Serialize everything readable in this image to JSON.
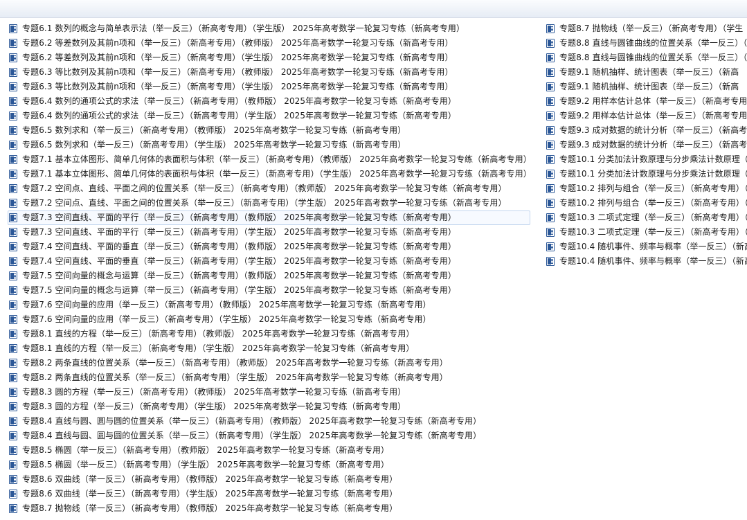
{
  "files": {
    "column1": [
      "专题6.1 数列的概念与简单表示法（举一反三）（新高考专用）（学生版） 2025年高考数学一轮复习专练（新高考专用）",
      "专题6.2 等差数列及其前n项和（举一反三）（新高考专用）（教师版） 2025年高考数学一轮复习专练（新高考专用）",
      "专题6.2 等差数列及其前n项和（举一反三）（新高考专用）（学生版） 2025年高考数学一轮复习专练（新高考专用）",
      "专题6.3 等比数列及其前n项和（举一反三）（新高考专用）（教师版） 2025年高考数学一轮复习专练（新高考专用）",
      "专题6.3 等比数列及其前n项和（举一反三）（新高考专用）（学生版） 2025年高考数学一轮复习专练（新高考专用）",
      "专题6.4 数列的通项公式的求法（举一反三）（新高考专用）（教师版） 2025年高考数学一轮复习专练（新高考专用）",
      "专题6.4 数列的通项公式的求法（举一反三）（新高考专用）（学生版） 2025年高考数学一轮复习专练（新高考专用）",
      "专题6.5 数列求和（举一反三）（新高考专用）（教师版） 2025年高考数学一轮复习专练（新高考专用）",
      "专题6.5 数列求和（举一反三）（新高考专用）（学生版） 2025年高考数学一轮复习专练（新高考专用）",
      "专题7.1 基本立体图形、简单几何体的表面积与体积（举一反三）（新高考专用）（教师版） 2025年高考数学一轮复习专练（新高考专用）",
      "专题7.1 基本立体图形、简单几何体的表面积与体积（举一反三）（新高考专用）（学生版） 2025年高考数学一轮复习专练（新高考专用）",
      "专题7.2 空间点、直线、平面之间的位置关系（举一反三）（新高考专用）（教师版） 2025年高考数学一轮复习专练（新高考专用）",
      "专题7.2 空间点、直线、平面之间的位置关系（举一反三）（新高考专用）（学生版） 2025年高考数学一轮复习专练（新高考专用）",
      "专题7.3 空间直线、平面的平行（举一反三）（新高考专用）（教师版） 2025年高考数学一轮复习专练（新高考专用）",
      "专题7.3 空间直线、平面的平行（举一反三）（新高考专用）（学生版） 2025年高考数学一轮复习专练（新高考专用）",
      "专题7.4 空间直线、平面的垂直（举一反三）（新高考专用）（教师版） 2025年高考数学一轮复习专练（新高考专用）",
      "专题7.4 空间直线、平面的垂直（举一反三）（新高考专用）（学生版） 2025年高考数学一轮复习专练（新高考专用）",
      "专题7.5 空间向量的概念与运算（举一反三）（新高考专用）（教师版） 2025年高考数学一轮复习专练（新高考专用）",
      "专题7.5 空间向量的概念与运算（举一反三）（新高考专用）（学生版） 2025年高考数学一轮复习专练（新高考专用）",
      "专题7.6 空间向量的应用（举一反三）（新高考专用）（教师版） 2025年高考数学一轮复习专练（新高考专用）",
      "专题7.6 空间向量的应用（举一反三）（新高考专用）（学生版） 2025年高考数学一轮复习专练（新高考专用）",
      "专题8.1 直线的方程（举一反三）（新高考专用）（教师版） 2025年高考数学一轮复习专练（新高考专用）",
      "专题8.1 直线的方程（举一反三）（新高考专用）（学生版） 2025年高考数学一轮复习专练（新高考专用）",
      "专题8.2 两条直线的位置关系（举一反三）（新高考专用）（教师版） 2025年高考数学一轮复习专练（新高考专用）",
      "专题8.2 两条直线的位置关系（举一反三）（新高考专用）（学生版） 2025年高考数学一轮复习专练（新高考专用）",
      "专题8.3 圆的方程（举一反三）（新高考专用）（教师版） 2025年高考数学一轮复习专练（新高考专用）",
      "专题8.3 圆的方程（举一反三）（新高考专用）（学生版） 2025年高考数学一轮复习专练（新高考专用）",
      "专题8.4 直线与圆、圆与圆的位置关系（举一反三）（新高考专用）（教师版） 2025年高考数学一轮复习专练（新高考专用）",
      "专题8.4 直线与圆、圆与圆的位置关系（举一反三）（新高考专用）（学生版） 2025年高考数学一轮复习专练（新高考专用）",
      "专题8.5 椭圆（举一反三）（新高考专用）（教师版） 2025年高考数学一轮复习专练（新高考专用）",
      "专题8.5 椭圆（举一反三）（新高考专用）（学生版） 2025年高考数学一轮复习专练（新高考专用）",
      "专题8.6 双曲线（举一反三）（新高考专用）（教师版） 2025年高考数学一轮复习专练（新高考专用）",
      "专题8.6 双曲线（举一反三）（新高考专用）（学生版） 2025年高考数学一轮复习专练（新高考专用）",
      "专题8.7 抛物线（举一反三）（新高考专用）（教师版） 2025年高考数学一轮复习专练（新高考专用）"
    ],
    "column2": [
      "专题8.7 抛物线（举一反三）（新高考专用）（学生",
      "专题8.8 直线与圆锥曲线的位置关系（举一反三）（",
      "专题8.8 直线与圆锥曲线的位置关系（举一反三）（",
      "专题9.1 随机抽样、统计图表（举一反三）（新高",
      "专题9.1 随机抽样、统计图表（举一反三）（新高",
      "专题9.2 用样本估计总体（举一反三）（新高考专用",
      "专题9.2 用样本估计总体（举一反三）（新高考专用",
      "专题9.3 成对数据的统计分析（举一反三）（新高考",
      "专题9.3 成对数据的统计分析（举一反三）（新高考",
      "专题10.1 分类加法计数原理与分步乘法计数原理（举",
      "专题10.1 分类加法计数原理与分步乘法计数原理（举",
      "专题10.2 排列与组合（举一反三）（新高考专用）（",
      "专题10.2 排列与组合（举一反三）（新高考专用）（",
      "专题10.3 二项式定理（举一反三）（新高考专用）（",
      "专题10.3 二项式定理（举一反三）（新高考专用）（",
      "专题10.4 随机事件、频率与概率（举一反三）（新高",
      "专题10.4 随机事件、频率与概率（举一反三）（新高"
    ]
  },
  "icon": "word-document-icon"
}
